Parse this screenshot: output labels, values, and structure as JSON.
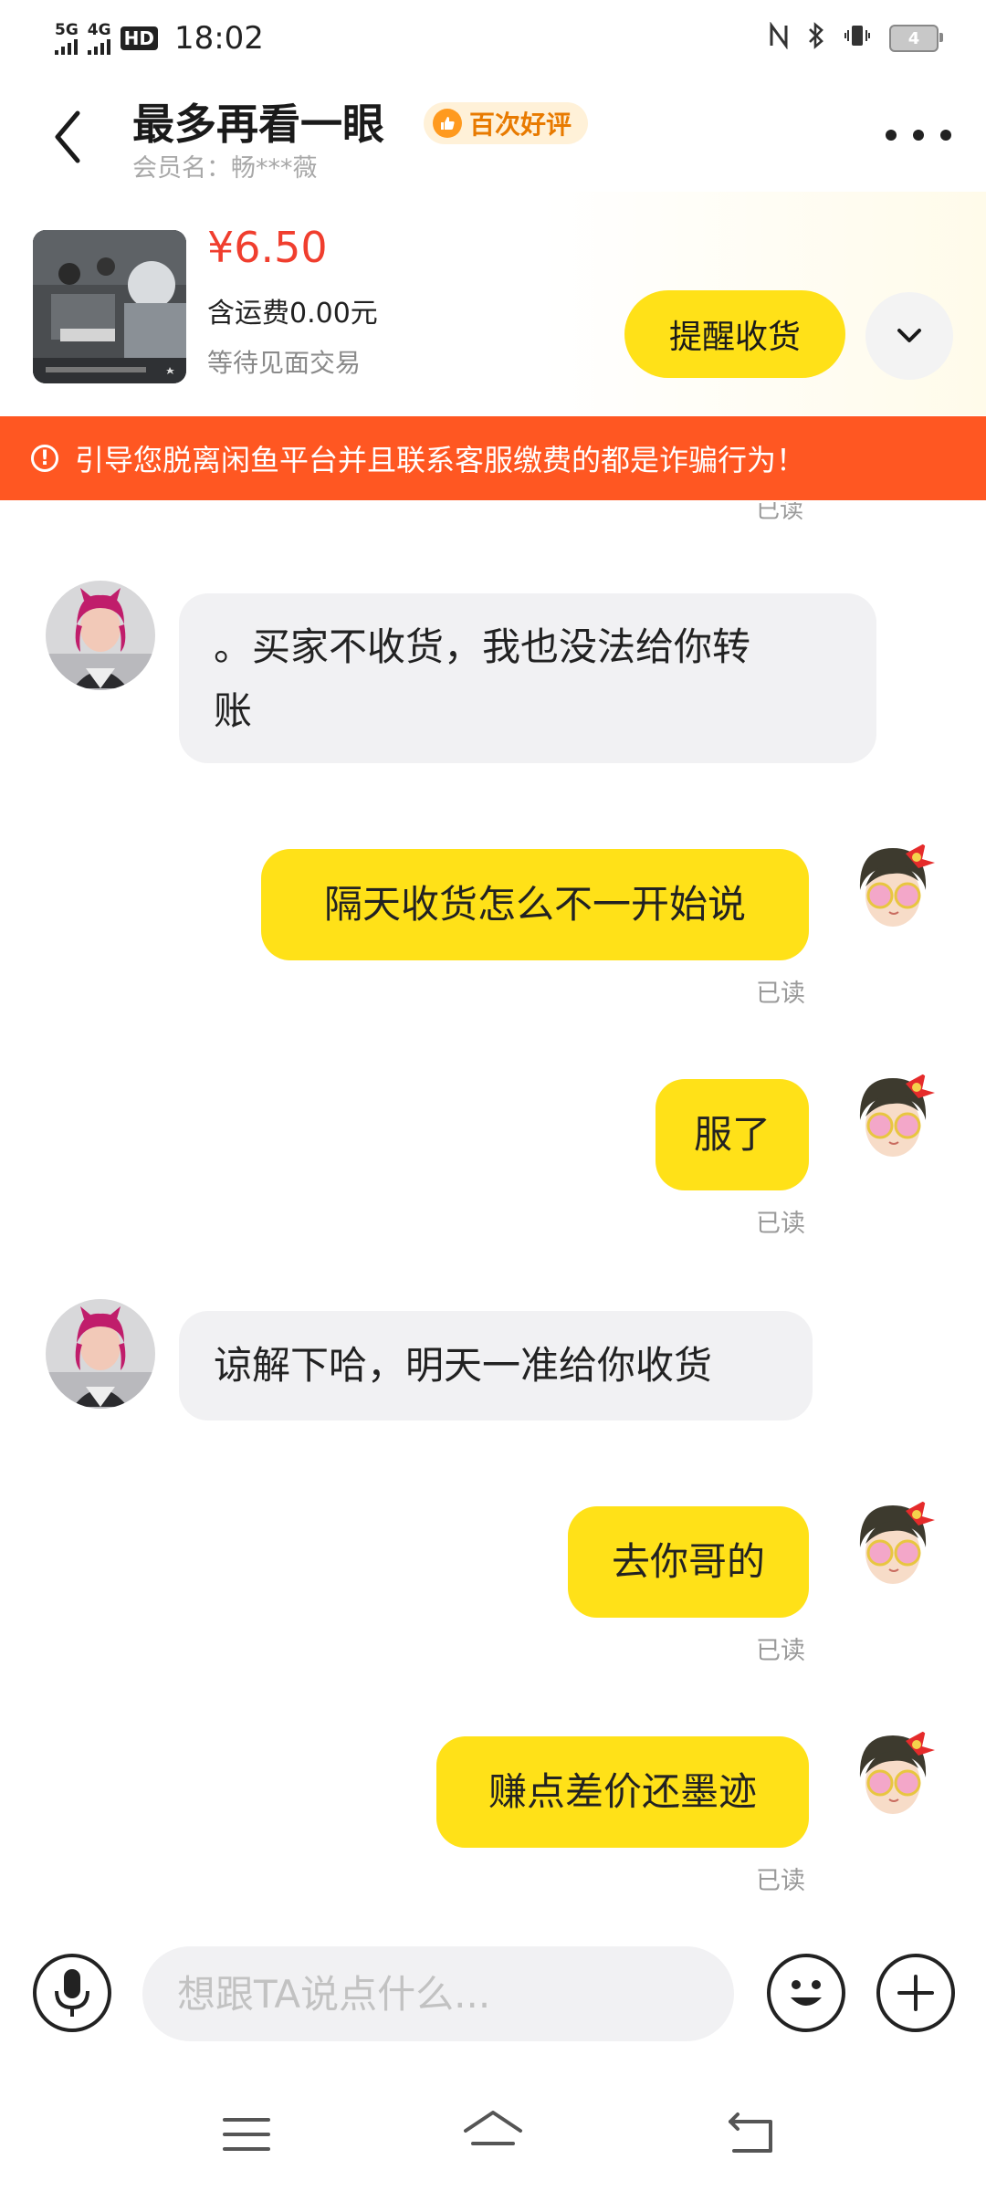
{
  "status_bar": {
    "signal_1": "5G",
    "signal_2": "4G",
    "hd": "HD",
    "time": "18:02",
    "battery": "4"
  },
  "header": {
    "title": "最多再看一眼",
    "badge": "百次好评",
    "member_name": "会员名：畅***薇"
  },
  "product": {
    "price": "¥6.50",
    "shipping": "含运费0.00元",
    "trade_status": "等待见面交易",
    "remind_button": "提醒收货"
  },
  "warning": {
    "text": "引导您脱离闲鱼平台并且联系客服缴费的都是诈骗行为！"
  },
  "partial_read": "已读",
  "messages": [
    {
      "side": "in",
      "lines": [
        "。买家不收货，我也没法给你转",
        "账"
      ]
    },
    {
      "side": "out",
      "text": "隔天收货怎么不一开始说",
      "status": "已读"
    },
    {
      "side": "out",
      "text": "服了",
      "status": "已读"
    },
    {
      "side": "in",
      "text": "谅解下哈，明天一准给你收货"
    },
    {
      "side": "out",
      "text": "去你哥的",
      "status": "已读"
    },
    {
      "side": "out",
      "text": "赚点差价还墨迹",
      "status": "已读"
    }
  ],
  "input": {
    "placeholder": "想跟TA说点什么..."
  },
  "icons": {
    "back": "back-arrow-icon",
    "more": "more-dots-icon",
    "expand": "chevron-down-icon",
    "mic": "microphone-icon",
    "emoji": "emoji-icon",
    "plus": "plus-icon",
    "nav_menu": "menu-icon",
    "nav_home": "home-icon",
    "nav_back": "back-icon"
  },
  "colors": {
    "accent_yellow": "#ffe118",
    "warning_red": "#ff5722",
    "price_red": "#f03e2e",
    "badge_orange": "#e87a00"
  }
}
